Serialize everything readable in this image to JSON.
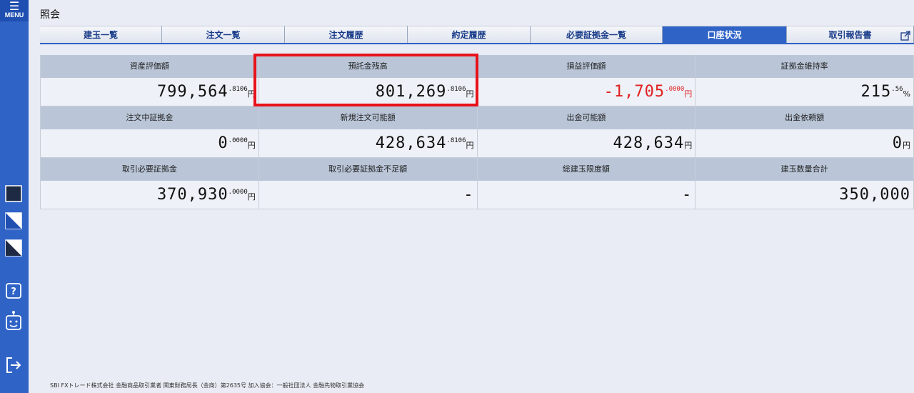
{
  "sidebar": {
    "menu_label": "MENU",
    "icons": [
      "theme-dark-icon",
      "theme-split-light-icon",
      "theme-split-dark-icon",
      "help-icon",
      "chatbot-icon",
      "logout-icon"
    ]
  },
  "page": {
    "title": "照会"
  },
  "tabs": [
    {
      "label": "建玉一覧"
    },
    {
      "label": "注文一覧"
    },
    {
      "label": "注文履歴"
    },
    {
      "label": "約定履歴"
    },
    {
      "label": "必要証拠金一覧"
    },
    {
      "label": "口座状況"
    },
    {
      "label": "取引報告書"
    }
  ],
  "account": {
    "rows": [
      [
        {
          "label": "資産評価額",
          "value": "799,564",
          "decimal": ".8106",
          "unit": "円"
        },
        {
          "label": "預託金残高",
          "value": "801,269",
          "decimal": ".8106",
          "unit": "円"
        },
        {
          "label": "損益評価額",
          "value": "-1,705",
          "decimal": ".0000",
          "unit": "円"
        },
        {
          "label": "証拠金維持率",
          "value": "215",
          "decimal": ".56",
          "unit": "%"
        }
      ],
      [
        {
          "label": "注文中証拠金",
          "value": "0",
          "decimal": ".0000",
          "unit": "円"
        },
        {
          "label": "新規注文可能額",
          "value": "428,634",
          "decimal": ".8106",
          "unit": "円"
        },
        {
          "label": "出金可能額",
          "value": "428,634",
          "decimal": "",
          "unit": "円"
        },
        {
          "label": "出金依頼額",
          "value": "0",
          "decimal": "",
          "unit": "円"
        }
      ],
      [
        {
          "label": "取引必要証拠金",
          "value": "370,930",
          "decimal": ".0000",
          "unit": "円"
        },
        {
          "label": "取引必要証拠金不足額",
          "value": "-",
          "decimal": "",
          "unit": ""
        },
        {
          "label": "総建玉限度額",
          "value": "-",
          "decimal": "",
          "unit": ""
        },
        {
          "label": "建玉数量合計",
          "value": "350,000",
          "decimal": "",
          "unit": ""
        }
      ]
    ],
    "negative_color": "#e02020"
  },
  "footer": {
    "text": "SBI FXトレード株式会社 金融商品取引業者 関東財務局長（金商）第2635号 加入協会：一般社団法人 金融先物取引業協会"
  }
}
